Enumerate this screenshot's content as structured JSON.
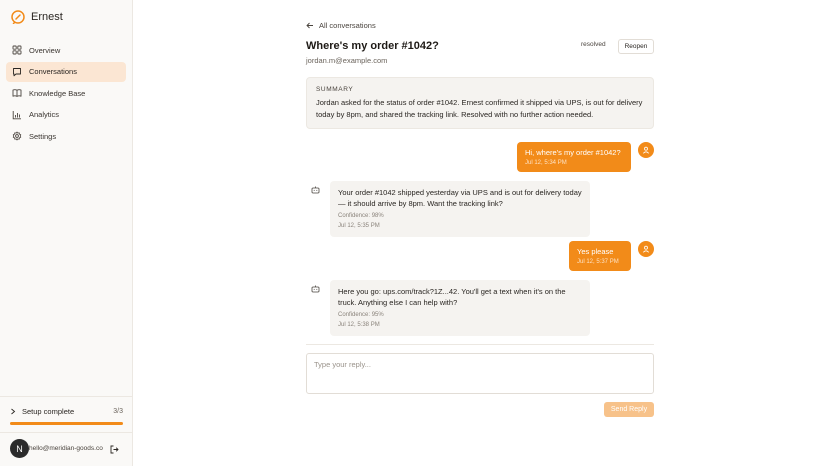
{
  "brand": {
    "name": "Ernest",
    "accent": "#f28b19"
  },
  "sidebar": {
    "items": [
      {
        "label": "Overview",
        "icon": "grid-icon"
      },
      {
        "label": "Conversations",
        "icon": "chat-icon",
        "active": true
      },
      {
        "label": "Knowledge Base",
        "icon": "book-icon"
      },
      {
        "label": "Analytics",
        "icon": "bar-chart-icon"
      },
      {
        "label": "Settings",
        "icon": "gear-icon"
      }
    ],
    "setup": {
      "label": "Setup complete",
      "count": "3/3",
      "progress": 1.0
    },
    "account": {
      "avatar_letter": "N",
      "email": "hello@meridian-goods.com"
    }
  },
  "conversation": {
    "back_label": "All conversations",
    "title": "Where's my order #1042?",
    "email": "jordan.m@example.com",
    "status": "resolved",
    "reopen_label": "Reopen",
    "summary_label": "SUMMARY",
    "summary_text": "Jordan asked for the status of order #1042. Ernest confirmed it shipped via UPS, is out for delivery today by 8pm, and shared the tracking link. Resolved with no further action needed.",
    "messages": [
      {
        "from": "user",
        "text": "Hi, where's my order #1042?",
        "time": "Jul 12, 5:34 PM"
      },
      {
        "from": "bot",
        "text": "Your order #1042 shipped yesterday via UPS and is out for delivery today — it should arrive by 8pm. Want the tracking link?",
        "confidence": "Confidence: 98%",
        "time": "Jul 12, 5:35 PM"
      },
      {
        "from": "user",
        "text": "Yes please",
        "time": "Jul 12, 5:37 PM"
      },
      {
        "from": "bot",
        "text": "Here you go: ups.com/track?1Z...42. You'll get a text when it's on the truck. Anything else I can help with?",
        "confidence": "Confidence: 95%",
        "time": "Jul 12, 5:38 PM"
      }
    ],
    "reply_placeholder": "Type your reply...",
    "send_label": "Send Reply"
  }
}
